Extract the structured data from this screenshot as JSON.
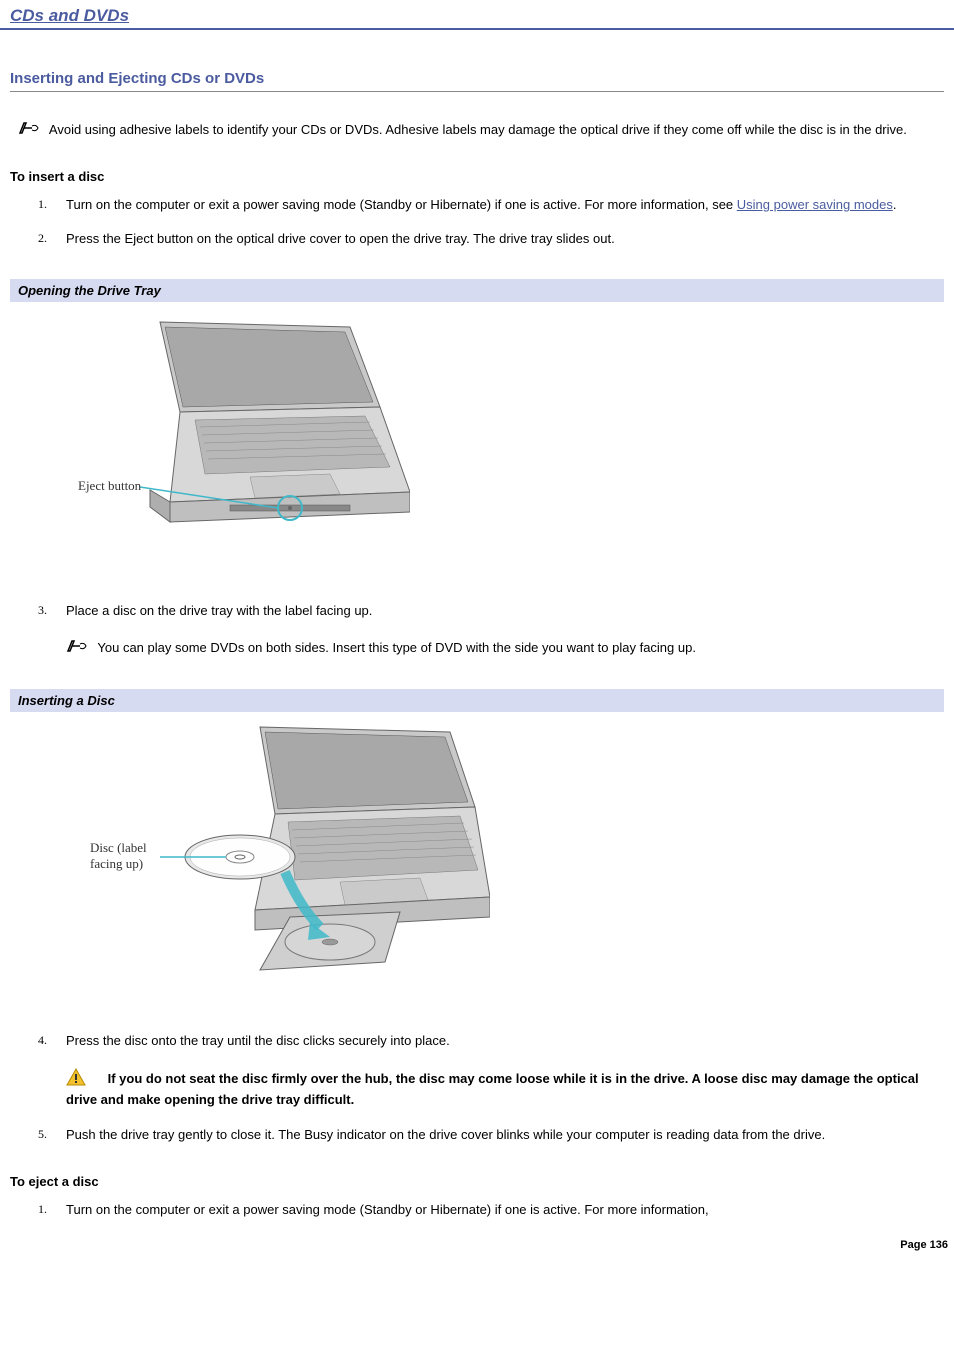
{
  "page": {
    "title": "CDs and DVDs",
    "number": "Page 136"
  },
  "section": {
    "heading": "Inserting and Ejecting CDs or DVDs",
    "top_note": "Avoid using adhesive labels to identify your CDs or DVDs. Adhesive labels may damage the optical drive if they come off while the disc is in the drive."
  },
  "insert": {
    "heading": "To insert a disc",
    "steps": [
      {
        "n": "1.",
        "pre": "Turn on the computer or exit a power saving mode (Standby or Hibernate) if one is active. For more information, see ",
        "link": "Using power saving modes",
        "post": "."
      },
      {
        "n": "2.",
        "text": "Press the Eject button on the optical drive cover to open the drive tray. The drive tray slides out."
      },
      {
        "n": "3.",
        "text": "Place a disc on the drive tray with the label facing up.",
        "subnote": "You can play some DVDs on both sides. Insert this type of DVD with the side you want to play facing up."
      },
      {
        "n": "4.",
        "text": "Press the disc onto the tray until the disc clicks securely into place.",
        "warning": "If you do not seat the disc firmly over the hub, the disc may come loose while it is in the drive. A loose disc may damage the optical drive and make opening the drive tray difficult."
      },
      {
        "n": "5.",
        "text": "Push the drive tray gently to close it. The Busy indicator on the drive cover blinks while your computer is reading data from the drive."
      }
    ]
  },
  "figures": {
    "f1": {
      "caption": "Opening the Drive Tray",
      "label": "Eject button"
    },
    "f2": {
      "caption": "Inserting a Disc",
      "label": "Disc (label\nfacing up)"
    }
  },
  "eject": {
    "heading": "To eject a disc",
    "steps": [
      {
        "n": "1.",
        "text": "Turn on the computer or exit a power saving mode (Standby or Hibernate) if one is active. For more information,"
      }
    ]
  }
}
